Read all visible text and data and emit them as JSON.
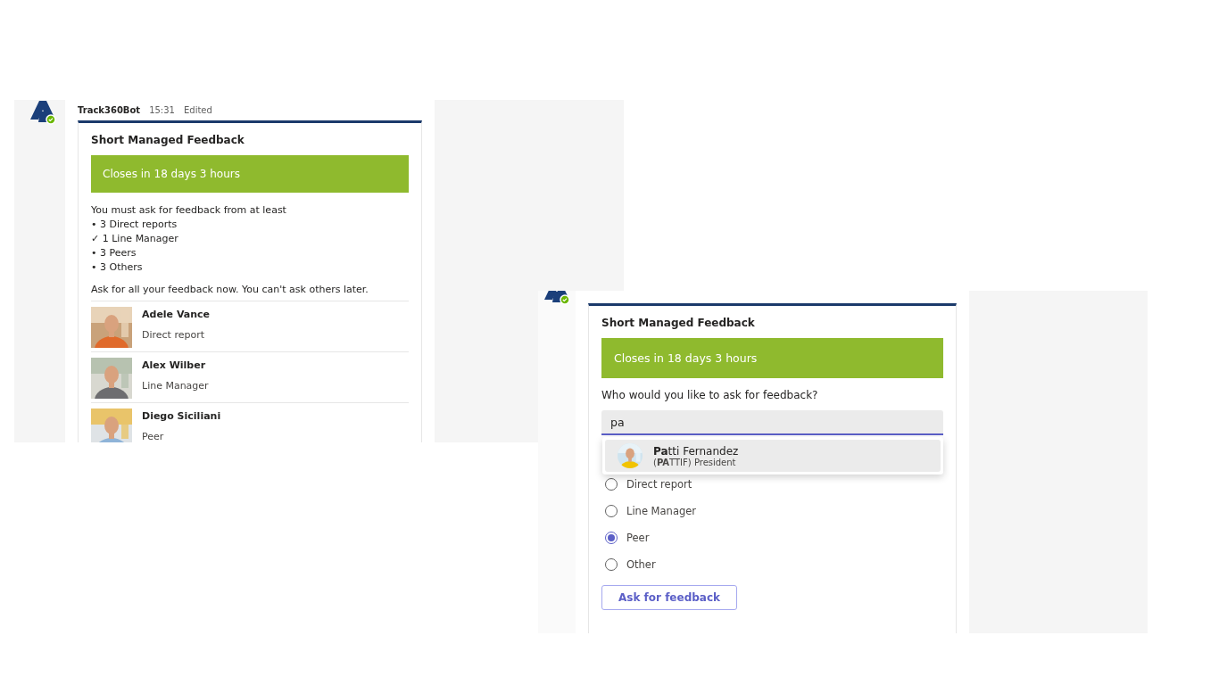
{
  "first_message": {
    "sender": "Track360Bot",
    "time": "15:31",
    "status": "Edited",
    "card": {
      "title": "Short Managed Feedback",
      "banner": "Closes in 18 days 3 hours",
      "intro": "You must ask for feedback from at least",
      "requirements": [
        "• 3 Direct reports",
        "✓ 1 Line Manager",
        "• 3 Peers",
        "• 3 Others"
      ],
      "note": "Ask for all your feedback now. You can't ask others later.",
      "people": [
        {
          "name": "Adele Vance",
          "role": "Direct report"
        },
        {
          "name": "Alex Wilber",
          "role": "Line Manager"
        },
        {
          "name": "Diego Siciliani",
          "role": "Peer"
        }
      ]
    }
  },
  "second_message": {
    "card": {
      "title": "Short Managed Feedback",
      "banner": "Closes in 18 days 3 hours",
      "question": "Who would you like to ask for feedback?",
      "search": {
        "value": "pa"
      },
      "suggestion": {
        "name": "**Pa**tti Fernandez",
        "detail": "(**PA**TTIF) President"
      },
      "roles": [
        {
          "label": "Direct report",
          "selected": false
        },
        {
          "label": "Line Manager",
          "selected": false
        },
        {
          "label": "Peer",
          "selected": true
        },
        {
          "label": "Other",
          "selected": false
        }
      ],
      "button": "Ask for feedback"
    }
  }
}
